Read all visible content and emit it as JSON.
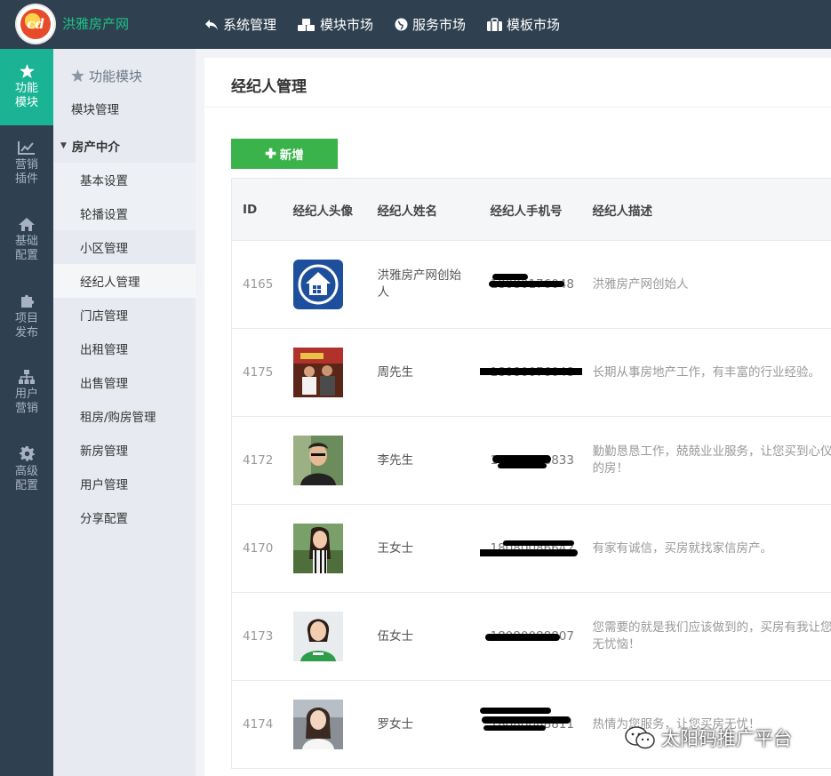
{
  "header": {
    "site_name": "洪雅房产网",
    "logo_text": "cd",
    "nav": [
      {
        "label": "系统管理",
        "icon": "reply-icon"
      },
      {
        "label": "模块市场",
        "icon": "cubes-icon"
      },
      {
        "label": "服务市场",
        "icon": "globe-icon"
      },
      {
        "label": "模板市场",
        "icon": "briefcase-icon"
      }
    ]
  },
  "iconbar": [
    {
      "l1": "功能",
      "l2": "模块",
      "icon": "star-icon",
      "active": true
    },
    {
      "l1": "营销",
      "l2": "插件",
      "icon": "line-chart-icon"
    },
    {
      "l1": "基础",
      "l2": "配置",
      "icon": "home-icon"
    },
    {
      "l1": "项目",
      "l2": "发布",
      "icon": "puzzle-icon"
    },
    {
      "l1": "用户",
      "l2": "营销",
      "icon": "sitemap-icon"
    },
    {
      "l1": "高级",
      "l2": "配置",
      "icon": "gear-icon"
    }
  ],
  "subnav": {
    "title": "功能模块",
    "module_mgmt": "模块管理",
    "group": "房产中介",
    "items": [
      "基本设置",
      "轮播设置",
      "小区管理",
      "经纪人管理",
      "门店管理",
      "出租管理",
      "出售管理",
      "租房/购房管理",
      "新房管理",
      "用户管理",
      "分享配置"
    ],
    "selected": "经纪人管理"
  },
  "main": {
    "title": "经纪人管理",
    "add_label": "新增",
    "columns": [
      "ID",
      "经纪人头像",
      "经纪人姓名",
      "经纪人手机号",
      "经纪人描述"
    ],
    "rows": [
      {
        "id": "4165",
        "name": "洪雅房产网创始人",
        "phone": "18080176048",
        "desc": "洪雅房产网创始人"
      },
      {
        "id": "4175",
        "name": "周先生",
        "phone": "18080076048",
        "desc": "长期从事房地产工作，有丰富的行业经验。"
      },
      {
        "id": "4172",
        "name": "李先生",
        "phone": "18080088833",
        "desc": "勤勤恳恳工作，兢兢业业服务，让您买到心仪的房！"
      },
      {
        "id": "4170",
        "name": "王女士",
        "phone": "18080086642",
        "desc": "有家有诚信，买房就找家信房产。"
      },
      {
        "id": "4173",
        "name": "伍女士",
        "phone": "18080088807",
        "desc": "您需要的就是我们应该做到的，买房有我让您无忧恼！"
      },
      {
        "id": "4174",
        "name": "罗女士",
        "phone": "18080088811",
        "desc": "热情为您服务，让您买房无忧！"
      }
    ]
  },
  "watermark": "太阳码推广平台",
  "colors": {
    "topbar": "#2f4050",
    "active": "#1ab394",
    "brand": "#1cc286",
    "add_button": "#3ab44a"
  }
}
